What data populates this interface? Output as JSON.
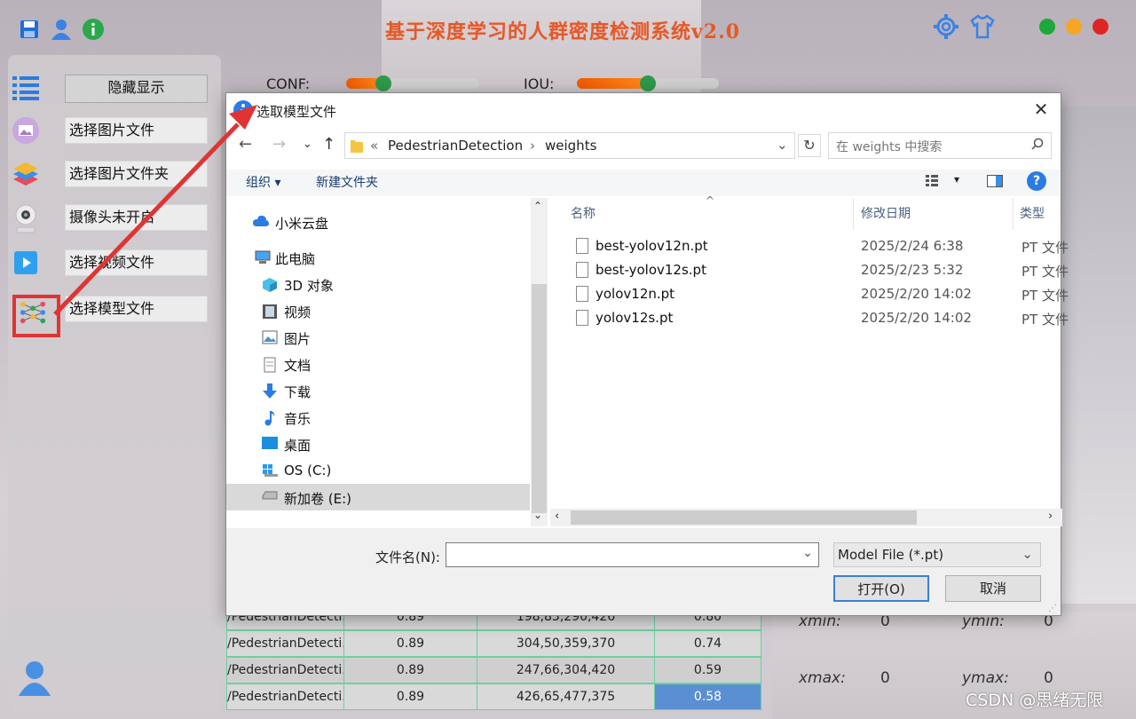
{
  "app": {
    "title": "基于深度学习的人群密度检测系统v2.0",
    "accent": "#e25a2b"
  },
  "sidebar": {
    "items": [
      {
        "label": "隐藏显示",
        "icon": "list-icon"
      },
      {
        "label": "选择图片文件",
        "icon": "image-icon"
      },
      {
        "label": "选择图片文件夹",
        "icon": "layers-icon"
      },
      {
        "label": "摄像头未开启",
        "icon": "webcam-icon"
      },
      {
        "label": "选择视频文件",
        "icon": "video-icon"
      },
      {
        "label": "选择模型文件",
        "icon": "model-icon"
      }
    ]
  },
  "sliders": {
    "conf_label": "CONF:",
    "iou_label": "IOU:",
    "conf_value": 0.28,
    "iou_value": 0.5
  },
  "results_table": {
    "rows": [
      [
        "/PedestrianDetecti...",
        "0.89",
        "198,83,290,426",
        "0.80"
      ],
      [
        "/PedestrianDetecti...",
        "0.89",
        "304,50,359,370",
        "0.74"
      ],
      [
        "/PedestrianDetecti...",
        "0.89",
        "247,66,304,420",
        "0.59"
      ],
      [
        "/PedestrianDetecti...",
        "0.89",
        "426,65,477,375",
        "0.58"
      ]
    ]
  },
  "coords": {
    "xmin_label": "xmin:",
    "xmin_value": "0",
    "ymin_label": "ymin:",
    "ymin_value": "0",
    "xmax_label": "xmax:",
    "xmax_value": "0",
    "ymax_label": "ymax:",
    "ymax_value": "0"
  },
  "watermark": "CSDN @思绪无限",
  "dialog": {
    "title": "选取模型文件",
    "breadcrumb_prefix": "«",
    "breadcrumb": [
      "PedestrianDetection",
      "weights"
    ],
    "search_placeholder": "在 weights 中搜索",
    "organize": "组织 ▾",
    "new_folder": "新建文件夹",
    "nav_items": [
      {
        "label": "小米云盘",
        "icon": "cloud-icon"
      },
      {
        "label": "此电脑",
        "icon": "computer-icon"
      },
      {
        "label": "3D 对象",
        "icon": "cube-icon"
      },
      {
        "label": "视频",
        "icon": "film-icon"
      },
      {
        "label": "图片",
        "icon": "picture-icon"
      },
      {
        "label": "文档",
        "icon": "document-icon"
      },
      {
        "label": "下载",
        "icon": "download-icon"
      },
      {
        "label": "音乐",
        "icon": "music-icon"
      },
      {
        "label": "桌面",
        "icon": "desktop-icon"
      },
      {
        "label": "OS (C:)",
        "icon": "windows-drive-icon"
      },
      {
        "label": "新加卷 (E:)",
        "icon": "drive-icon"
      }
    ],
    "columns": {
      "name": "名称",
      "date": "修改日期",
      "type": "类型"
    },
    "files": [
      {
        "name": "best-yolov12n.pt",
        "date": "2025/2/24 6:38",
        "type": "PT 文件"
      },
      {
        "name": "best-yolov12s.pt",
        "date": "2025/2/23 5:32",
        "type": "PT 文件"
      },
      {
        "name": "yolov12n.pt",
        "date": "2025/2/20 14:02",
        "type": "PT 文件"
      },
      {
        "name": "yolov12s.pt",
        "date": "2025/2/20 14:02",
        "type": "PT 文件"
      }
    ],
    "filename_label": "文件名(N):",
    "filename_value": "",
    "filetype": "Model File (*.pt)",
    "open_button": "打开(O)",
    "cancel_button": "取消"
  }
}
